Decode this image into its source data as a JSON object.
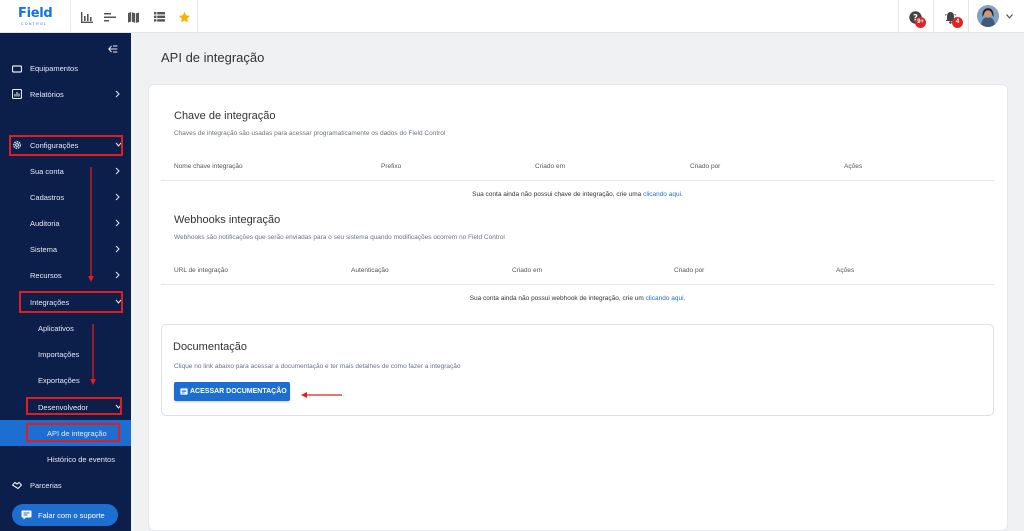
{
  "logo": {
    "word": "Field",
    "sub": "CONTROL"
  },
  "topbar": {
    "icons": [
      "bar-chart-icon",
      "list-icon",
      "map-icon",
      "table-icon",
      "star-icon"
    ],
    "help_badge": "9+",
    "notif_badge": "4"
  },
  "sidebar": {
    "items": [
      {
        "label": "Equipamentos"
      },
      {
        "label": "Relatórios"
      },
      {
        "label": "Configurações"
      },
      {
        "label": "Sua conta"
      },
      {
        "label": "Cadastros"
      },
      {
        "label": "Auditoria"
      },
      {
        "label": "Sistema"
      },
      {
        "label": "Recursos"
      },
      {
        "label": "Integrações"
      },
      {
        "label": "Aplicativos"
      },
      {
        "label": "Importações"
      },
      {
        "label": "Exportações"
      },
      {
        "label": "Desenvolvedor"
      },
      {
        "label": "API de integração"
      },
      {
        "label": "Histórico de eventos"
      },
      {
        "label": "Parcerias"
      }
    ],
    "support_label": "Falar com o suporte"
  },
  "page": {
    "title": "API de integração"
  },
  "keys_section": {
    "title": "Chave de integração",
    "description": "Chaves de integração são usadas para acessar programaticamente os dados do Field Control",
    "columns": [
      "Nome chave integração",
      "Prefixo",
      "Criado em",
      "Criado por",
      "Ações"
    ],
    "empty_text": "Sua conta ainda não possui chave de integração, crie uma ",
    "empty_link": "clicando aqui."
  },
  "webhooks_section": {
    "title": "Webhooks integração",
    "description": "Webhooks são notificações que serão enviadas para o seu sistema quando modificações ocorrem no Field Control",
    "columns": [
      "URL de integração",
      "Autenticação",
      "Criado em",
      "Criado por",
      "Ações"
    ],
    "empty_text": "Sua conta ainda não possui webhook de integração, crie um ",
    "empty_link": "clicando aqui."
  },
  "docs_section": {
    "title": "Documentação",
    "description": "Clique no link abaixo para acessar a documentação e ter mais detalhes de como fazer a integração",
    "button_label": "ACESSAR DOCUMENTAÇÃO"
  },
  "colors": {
    "accent": "#1c6fd1",
    "sidebar_bg": "#0c1e4a",
    "highlight": "#e11d1d",
    "star": "#f5b301"
  }
}
